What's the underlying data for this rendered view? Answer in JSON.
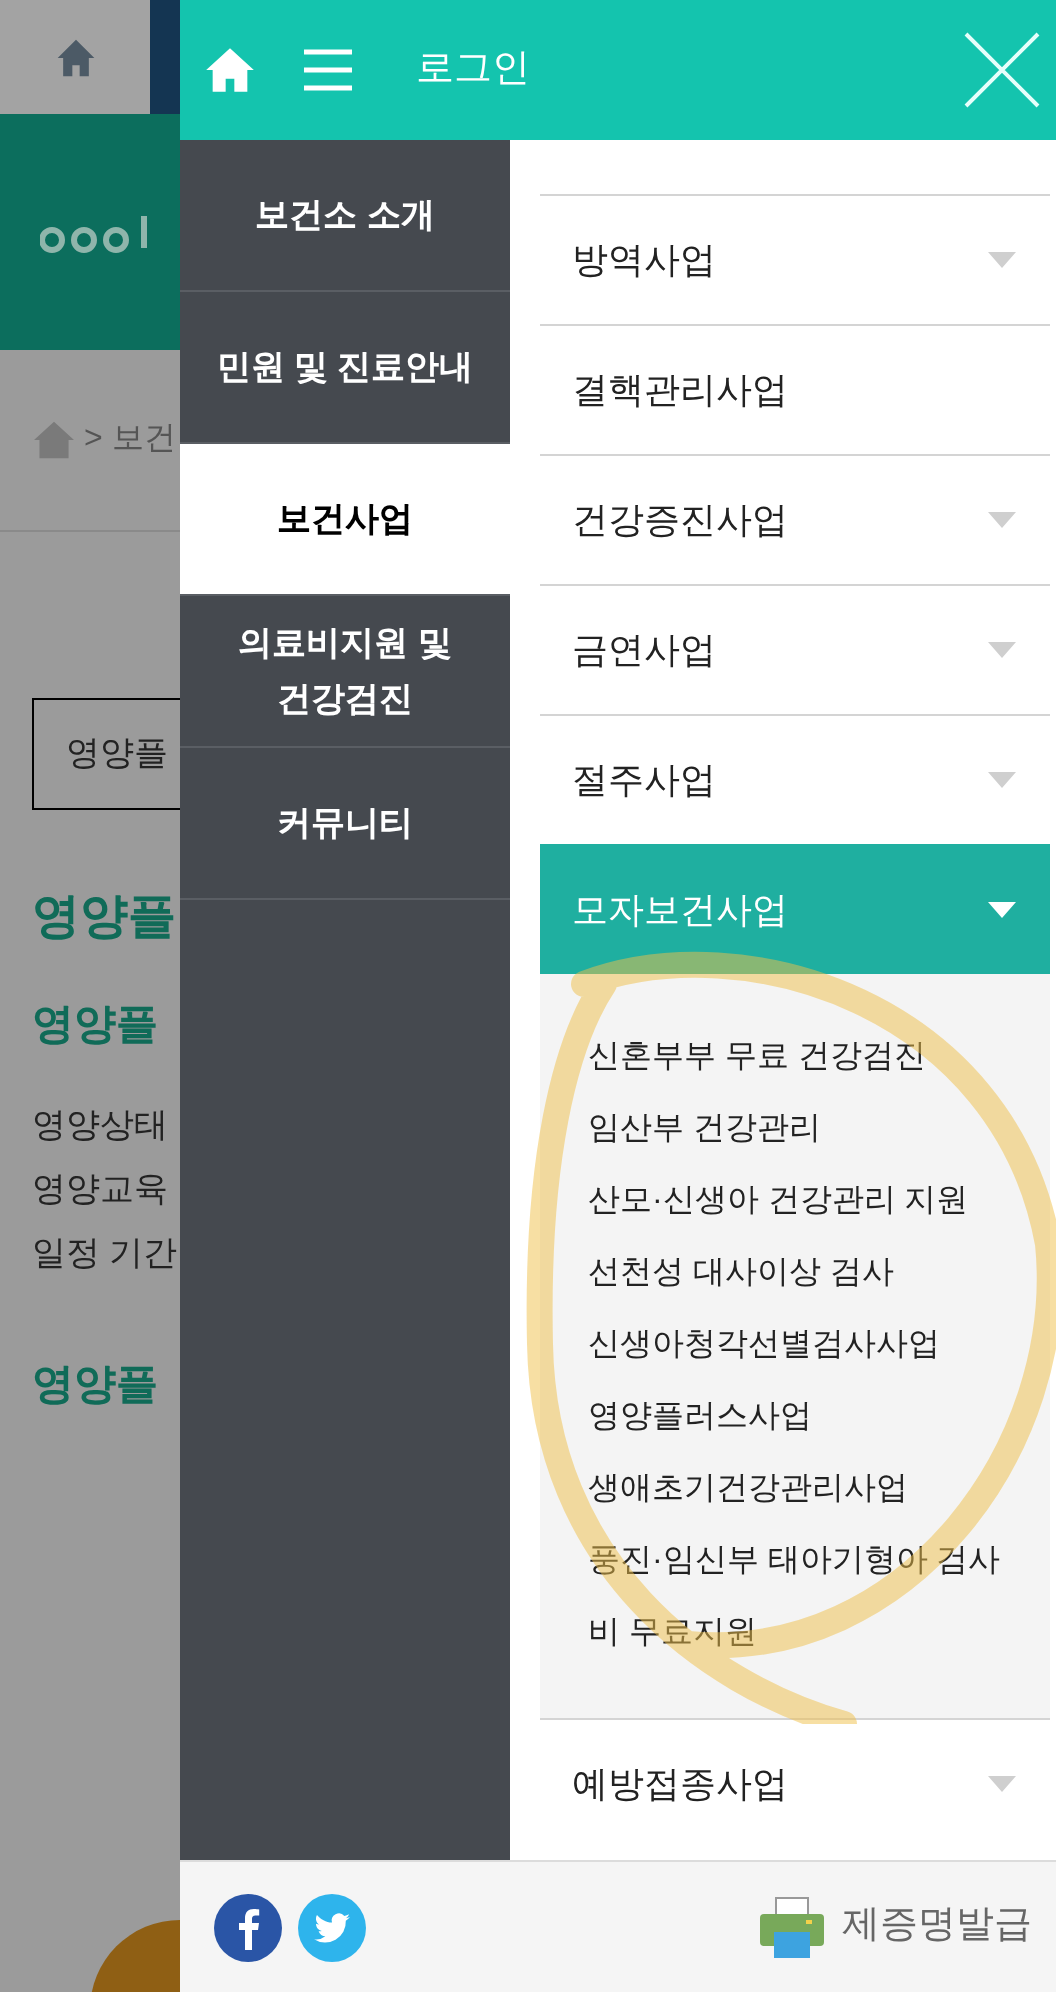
{
  "background_page": {
    "breadcrumb": "> 보건",
    "select_value": "영양플",
    "heading": "영양플",
    "subheading": "영양플",
    "paragraph_lines": [
      "영양상태",
      "영양교육",
      "일정 기간"
    ],
    "heading_2": "영양플"
  },
  "drawer_header": {
    "login_link": "로그인"
  },
  "main_menu": [
    {
      "label": "보건소 소개",
      "selected": false
    },
    {
      "label": "민원 및 진료안내",
      "selected": false
    },
    {
      "label": "보건사업",
      "selected": true
    },
    {
      "label": "의료비지원 및 건강검진",
      "selected": false
    },
    {
      "label": "커뮤니티",
      "selected": false
    }
  ],
  "sub_menu": [
    {
      "label": "방역사업",
      "expandable": true,
      "expanded": false
    },
    {
      "label": "결핵관리사업",
      "expandable": false,
      "expanded": false
    },
    {
      "label": "건강증진사업",
      "expandable": true,
      "expanded": false
    },
    {
      "label": "금연사업",
      "expandable": true,
      "expanded": false
    },
    {
      "label": "절주사업",
      "expandable": true,
      "expanded": false
    },
    {
      "label": "모자보건사업",
      "expandable": true,
      "expanded": true,
      "children": [
        "신혼부부 무료 건강검진",
        "임산부 건강관리",
        "산모·신생아 건강관리 지원",
        "선천성 대사이상 검사",
        "신생아청각선별검사사업",
        "영양플러스사업",
        "생애초기건강관리사업",
        "풍진·임신부 태아기형아 검사비 무료지원"
      ]
    },
    {
      "label": "예방접종사업",
      "expandable": true,
      "expanded": false
    }
  ],
  "footer": {
    "certificate_link": "제증명발급"
  }
}
